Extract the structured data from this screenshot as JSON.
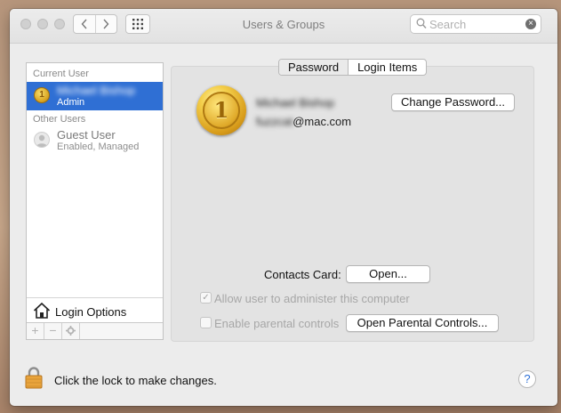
{
  "window": {
    "title": "Users & Groups"
  },
  "search": {
    "placeholder": "Search",
    "value": ""
  },
  "sidebar": {
    "current_user_heading": "Current User",
    "current_user": {
      "name": "Michael Bishop",
      "role": "Admin"
    },
    "other_users_heading": "Other Users",
    "guest_user": {
      "name": "Guest User",
      "status": "Enabled, Managed"
    },
    "login_options_label": "Login Options",
    "tools": {
      "add": "+",
      "remove": "−"
    }
  },
  "tabs": [
    {
      "label": "Password",
      "selected": true
    },
    {
      "label": "Login Items",
      "selected": false
    }
  ],
  "user_detail": {
    "full_name": "Michael Bishop",
    "email_hidden_part": "fuzzcat",
    "email_domain": "@mac.com",
    "avatar_number": "1",
    "change_password_label": "Change Password...",
    "contacts_card_label": "Contacts Card:",
    "open_label": "Open...",
    "allow_admin_label": "Allow user to administer this computer",
    "allow_admin_checked": true,
    "parental_controls_label": "Enable parental controls",
    "parental_controls_checked": false,
    "open_parental_label": "Open Parental Controls..."
  },
  "footer": {
    "lock_label": "Click the lock to make changes.",
    "help_label": "?"
  },
  "colors": {
    "selection": "#2f6fd4",
    "window_bg": "#ececec",
    "panel_bg": "#e3e3e3"
  }
}
